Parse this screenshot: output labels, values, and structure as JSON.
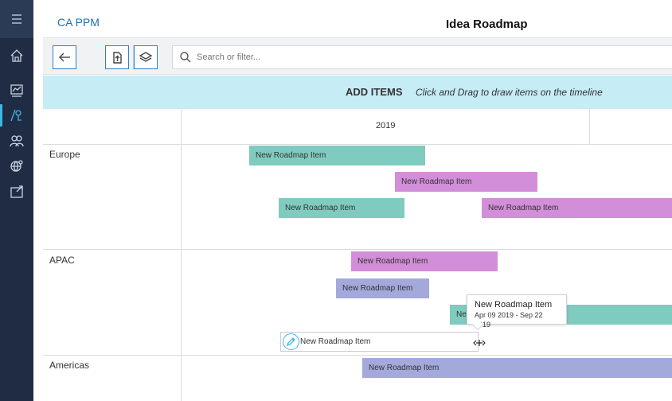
{
  "app": {
    "brand": "CA PPM",
    "title": "Idea Roadmap"
  },
  "rail": {
    "items": [
      {
        "icon": "menu-icon"
      },
      {
        "icon": "home-icon"
      },
      {
        "icon": "dashboard-icon"
      },
      {
        "icon": "roadmap-icon",
        "active": true
      },
      {
        "icon": "resources-icon"
      },
      {
        "icon": "global-icon"
      },
      {
        "icon": "inbox-icon"
      }
    ]
  },
  "toolbar": {
    "back_icon": "arrow-left-icon",
    "export_icon": "export-icon",
    "layers_icon": "layers-icon",
    "search_placeholder": "Search or filter..."
  },
  "banner": {
    "title": "ADD ITEMS",
    "hint": "Click and Drag to draw items on the timeline"
  },
  "timeline": {
    "year": "2019",
    "groups": [
      {
        "name": "Europe",
        "items": [
          {
            "label": "New Roadmap Item",
            "color": "teal"
          },
          {
            "label": "New Roadmap Item",
            "color": "pink"
          },
          {
            "label": "New Roadmap Item",
            "color": "teal"
          },
          {
            "label": "New Roadmap Item",
            "color": "pink"
          }
        ]
      },
      {
        "name": "APAC",
        "items": [
          {
            "label": "New Roadmap Item",
            "color": "pink"
          },
          {
            "label": "New Roadmap Item",
            "color": "blue"
          },
          {
            "label": "New Roadmap Item",
            "color": "teal"
          }
        ]
      },
      {
        "name": "Americas",
        "items": [
          {
            "label": "New Roadmap Item",
            "color": "blue"
          }
        ]
      }
    ],
    "new_item": {
      "label": "New Roadmap Item"
    },
    "tooltip": {
      "title": "New Roadmap Item",
      "dates": "Apr 09 2019 - Sep 22 2019"
    }
  },
  "colors": {
    "rail": "#1f2c43",
    "accent": "#3fb6e6",
    "banner": "#c6ecf6",
    "teal": "#7fcbbf",
    "pink": "#d28ed8",
    "blue": "#a4a9dc"
  }
}
